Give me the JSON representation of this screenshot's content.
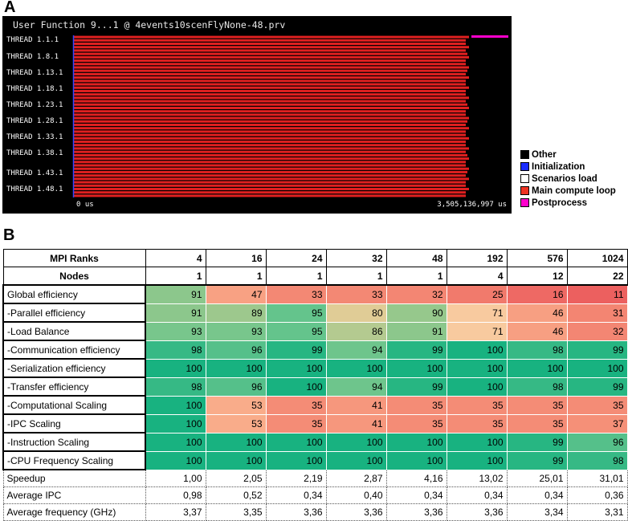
{
  "panel_labels": {
    "a": "A",
    "b": "B"
  },
  "trace": {
    "title": "User Function 9...1 @ 4events10scenFlyNone-48.prv",
    "axis_start": "0 us",
    "axis_end": "3,505,136,997 us",
    "thread_labels": [
      "THREAD 1.1.1",
      "THREAD 1.8.1",
      "THREAD 1.13.1",
      "THREAD 1.18.1",
      "THREAD 1.23.1",
      "THREAD 1.28.1",
      "THREAD 1.33.1",
      "THREAD 1.38.1",
      "THREAD 1.43.1",
      "THREAD 1.48.1"
    ],
    "thread_count": 48,
    "colors": {
      "background": "#000000",
      "compute": "#e02020",
      "init": "#3344ff",
      "postprocess": "#ff00cc"
    }
  },
  "legend": [
    {
      "label": "Other",
      "color": "#000000"
    },
    {
      "label": "Initialization",
      "color": "#1a2cff"
    },
    {
      "label": "Scenarios load",
      "color": "#ffffff"
    },
    {
      "label": "Main compute loop",
      "color": "#ee3322"
    },
    {
      "label": "Postprocess",
      "color": "#ff00cc"
    }
  ],
  "chart_data": [
    {
      "type": "table",
      "columns_label": "MPI Ranks",
      "nodes_label": "Nodes",
      "mpi_ranks": [
        "4",
        "16",
        "24",
        "32",
        "48",
        "192",
        "576",
        "1024"
      ],
      "nodes": [
        "1",
        "1",
        "1",
        "1",
        "1",
        "4",
        "12",
        "22"
      ],
      "metrics": [
        {
          "label": "Global efficiency",
          "values": [
            "91",
            "47",
            "33",
            "33",
            "32",
            "25",
            "16",
            "11"
          ]
        },
        {
          "label": "-Parallel efficiency",
          "values": [
            "91",
            "89",
            "95",
            "80",
            "90",
            "71",
            "46",
            "31"
          ]
        },
        {
          "label": "-Load Balance",
          "values": [
            "93",
            "93",
            "95",
            "86",
            "91",
            "71",
            "46",
            "32"
          ]
        },
        {
          "label": "-Communication efficiency",
          "values": [
            "98",
            "96",
            "99",
            "94",
            "99",
            "100",
            "98",
            "99"
          ]
        },
        {
          "label": "-Serialization efficiency",
          "values": [
            "100",
            "100",
            "100",
            "100",
            "100",
            "100",
            "100",
            "100"
          ]
        },
        {
          "label": "-Transfer efficiency",
          "values": [
            "98",
            "96",
            "100",
            "94",
            "99",
            "100",
            "98",
            "99"
          ]
        },
        {
          "label": "-Computational Scaling",
          "values": [
            "100",
            "53",
            "35",
            "41",
            "35",
            "35",
            "35",
            "35"
          ]
        },
        {
          "label": "-IPC Scaling",
          "values": [
            "100",
            "53",
            "35",
            "41",
            "35",
            "35",
            "35",
            "37"
          ]
        },
        {
          "label": "-Instruction Scaling",
          "values": [
            "100",
            "100",
            "100",
            "100",
            "100",
            "100",
            "99",
            "96"
          ]
        },
        {
          "label": "-CPU Frequency Scaling",
          "values": [
            "100",
            "100",
            "100",
            "100",
            "100",
            "100",
            "99",
            "98"
          ]
        }
      ],
      "extra_rows": [
        {
          "label": "Speedup",
          "values": [
            "1,00",
            "2,05",
            "2,19",
            "2,87",
            "4,16",
            "13,02",
            "25,01",
            "31,01"
          ]
        },
        {
          "label": "Average IPC",
          "values": [
            "0,98",
            "0,52",
            "0,34",
            "0,40",
            "0,34",
            "0,34",
            "0,34",
            "0,36"
          ]
        },
        {
          "label": "Average frequency (GHz)",
          "values": [
            "3,37",
            "3,35",
            "3,36",
            "3,36",
            "3,36",
            "3,36",
            "3,34",
            "3,31"
          ]
        }
      ]
    }
  ]
}
